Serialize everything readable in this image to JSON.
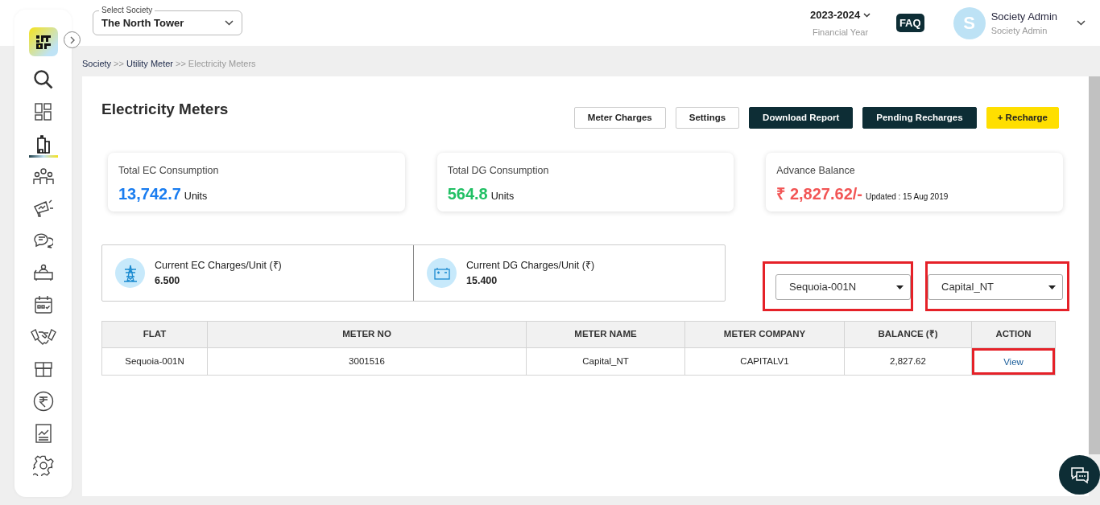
{
  "society_select": {
    "label": "Select Society",
    "value": "The North Tower"
  },
  "financial_year": {
    "value": "2023-2024",
    "caption": "Financial Year"
  },
  "faq": "FAQ",
  "user": {
    "initial": "S",
    "name": "Society Admin",
    "role": "Society Admin"
  },
  "sidebar": {
    "items": [
      {
        "selected": false
      },
      {
        "selected": false
      },
      {
        "selected": true
      },
      {
        "selected": false
      },
      {
        "selected": false
      },
      {
        "selected": false
      },
      {
        "selected": false
      },
      {
        "selected": false
      },
      {
        "selected": false
      },
      {
        "selected": false
      },
      {
        "selected": false
      },
      {
        "selected": false
      },
      {
        "selected": false
      }
    ]
  },
  "breadcrumb": [
    {
      "label": "Society",
      "current": false
    },
    {
      "label": "Utility Meter",
      "current": false
    },
    {
      "label": "Electricity Meters",
      "current": true
    }
  ],
  "breadcrumb_separator": ">>",
  "page_title": "Electricity Meters",
  "buttons": [
    {
      "label": "Meter Charges",
      "kind": "outline"
    },
    {
      "label": "Settings",
      "kind": "outline"
    },
    {
      "label": "Download Report",
      "kind": "dark"
    },
    {
      "label": "Pending Recharges",
      "kind": "dark"
    },
    {
      "label": "+ Recharge",
      "kind": "accent"
    }
  ],
  "stats": [
    {
      "label": "Total EC Consumption",
      "value": "13,742.7",
      "unit": "Units",
      "color": "#1a7df0"
    },
    {
      "label": "Total DG Consumption",
      "value": "564.8",
      "unit": "Units",
      "color": "#21c064"
    },
    {
      "label": "Advance Balance",
      "value": "₹ 2,827.62/-",
      "unit": "Updated : 15 Aug 2019",
      "color": "#f25555"
    }
  ],
  "charges": [
    {
      "label": "Current EC Charges/Unit (₹)",
      "value": "6.500"
    },
    {
      "label": "Current DG Charges/Unit (₹)",
      "value": "15.400"
    }
  ],
  "filters": [
    {
      "value": "Sequoia-001N",
      "highlighted": true
    },
    {
      "value": "Capital_NT",
      "highlighted": true
    }
  ],
  "table": {
    "columns": [
      "FLAT",
      "METER NO",
      "METER NAME",
      "METER COMPANY",
      "BALANCE (₹)",
      "ACTION"
    ],
    "rows": [
      {
        "cells": [
          "Sequoia-001N",
          "3001516",
          "Capital_NT",
          "CAPITALV1",
          "2,827.62"
        ],
        "action": "View",
        "action_highlighted": true
      }
    ]
  }
}
